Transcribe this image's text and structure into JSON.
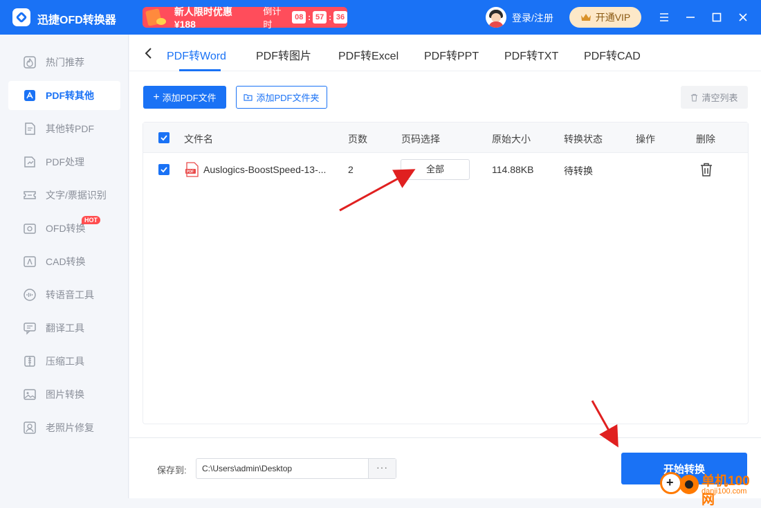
{
  "app": {
    "title": "迅捷OFD转换器"
  },
  "promo": {
    "text": "新人限时优惠 ¥188",
    "countdown_label": "倒计时",
    "hours": "08",
    "minutes": "57",
    "seconds": "36"
  },
  "header": {
    "login": "登录/注册",
    "vip": "开通VIP"
  },
  "sidebar": {
    "items": [
      {
        "label": "热门推荐",
        "icon": "hot-recommend-icon"
      },
      {
        "label": "PDF转其他",
        "icon": "pdf-convert-icon",
        "active": true
      },
      {
        "label": "其他转PDF",
        "icon": "to-pdf-icon"
      },
      {
        "label": "PDF处理",
        "icon": "pdf-process-icon"
      },
      {
        "label": "文字/票据识别",
        "icon": "ocr-icon"
      },
      {
        "label": "OFD转换",
        "icon": "ofd-icon",
        "badge": "HOT"
      },
      {
        "label": "CAD转换",
        "icon": "cad-icon"
      },
      {
        "label": "转语音工具",
        "icon": "voice-icon"
      },
      {
        "label": "翻译工具",
        "icon": "translate-icon"
      },
      {
        "label": "压缩工具",
        "icon": "compress-icon"
      },
      {
        "label": "图片转换",
        "icon": "image-icon"
      },
      {
        "label": "老照片修复",
        "icon": "photo-repair-icon"
      }
    ]
  },
  "tabs": [
    "PDF转Word",
    "PDF转图片",
    "PDF转Excel",
    "PDF转PPT",
    "PDF转TXT",
    "PDF转CAD"
  ],
  "toolbar": {
    "add_file": "添加PDF文件",
    "add_folder": "添加PDF文件夹",
    "clear": "清空列表"
  },
  "table": {
    "headers": {
      "filename": "文件名",
      "pages": "页数",
      "page_select": "页码选择",
      "size": "原始大小",
      "status": "转换状态",
      "action": "操作",
      "delete": "删除"
    },
    "rows": [
      {
        "filename": "Auslogics-BoostSpeed-13-...",
        "pages": "2",
        "page_select": "全部",
        "size": "114.88KB",
        "status": "待转换"
      }
    ]
  },
  "footer": {
    "save_label": "保存到:",
    "save_path": "C:\\Users\\admin\\Desktop",
    "browse": "···",
    "start": "开始转换"
  },
  "watermark": {
    "text": "单机100网",
    "url": "danji100.com"
  },
  "colors": {
    "primary": "#1a72f5",
    "promo": "#ff4d5b",
    "arrow": "#e02020"
  }
}
